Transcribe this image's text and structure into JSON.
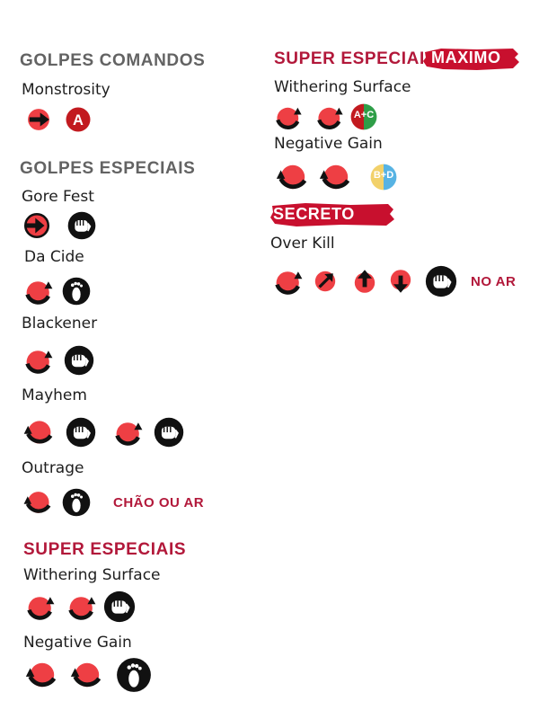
{
  "left": {
    "command_title": "GOLPES COMANDOS",
    "command_moves": [
      {
        "name": "Monstrosity"
      }
    ],
    "special_title": "GOLPES ESPECIAIS",
    "special_moves": [
      {
        "name": "Gore Fest"
      },
      {
        "name": "Da Cide"
      },
      {
        "name": "Blackener"
      },
      {
        "name": "Mayhem"
      },
      {
        "name": "Outrage",
        "note": "CHÃO OU AR"
      }
    ],
    "super_title": "SUPER ESPECIAIS",
    "super_moves": [
      {
        "name": "Withering Surface"
      },
      {
        "name": "Negative Gain"
      }
    ]
  },
  "right": {
    "super_title": "SUPER ESPECIAIS",
    "super_badge": "MAXIMO",
    "super_moves": [
      {
        "name": "Withering Surface",
        "button_label": "A+C"
      },
      {
        "name": "Negative Gain",
        "button_label": "B+D"
      }
    ],
    "secret_badge": "SECRETO",
    "secret_moves": [
      {
        "name": "Over Kill",
        "note": "NO AR"
      }
    ]
  },
  "colors": {
    "motion_red": "#ee3f44",
    "heading_red": "#b2183a",
    "heading_gray": "#636363",
    "brush_red": "#c8102e",
    "button_a_red": "#c21a1f",
    "button_c_green": "#2f9e48",
    "button_b_yellow": "#f2d16a",
    "button_d_blue": "#57b3e3"
  }
}
